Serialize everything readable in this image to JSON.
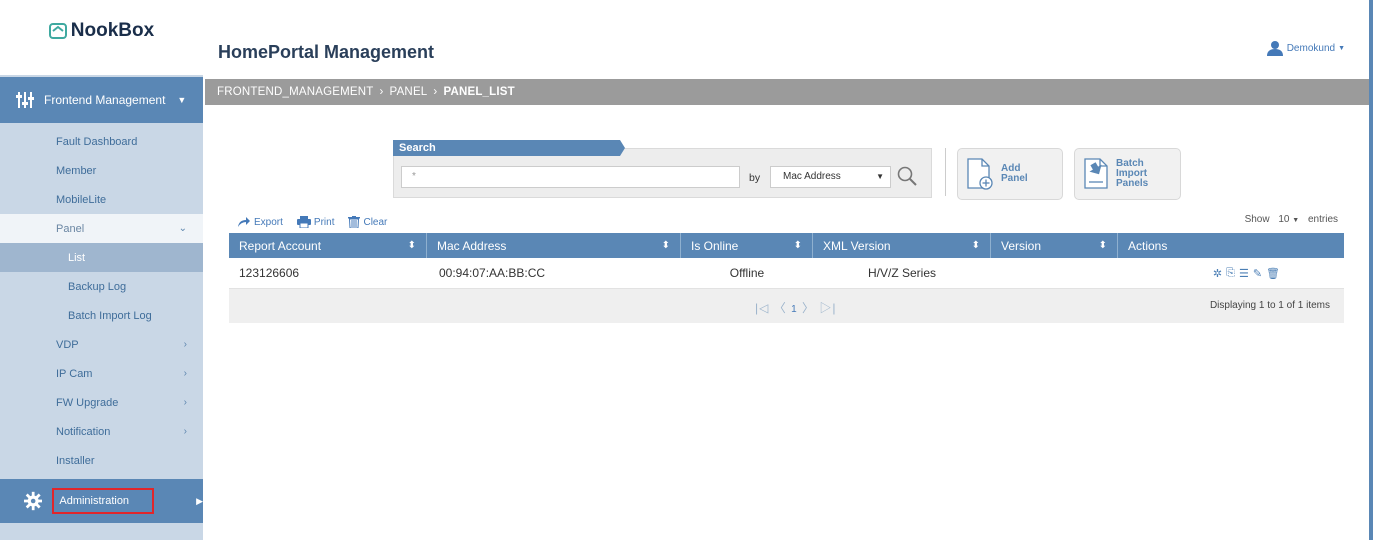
{
  "brand": {
    "logo_text": "NookBox"
  },
  "header": {
    "title": "HomePortal Management",
    "user_name": "Demokund"
  },
  "breadcrumb": {
    "part1": "FRONTEND_MANAGEMENT",
    "part2": "PANEL",
    "part3": "PANEL_LIST",
    "separator": "›"
  },
  "sidebar": {
    "section_label": "Frontend Management",
    "items": [
      {
        "label": "Fault Dashboard"
      },
      {
        "label": "Member"
      },
      {
        "label": "MobileLite"
      },
      {
        "label": "Panel"
      },
      {
        "label": "List"
      },
      {
        "label": "Backup Log"
      },
      {
        "label": "Batch Import Log"
      },
      {
        "label": "VDP"
      },
      {
        "label": "IP Cam"
      },
      {
        "label": "FW Upgrade"
      },
      {
        "label": "Notification"
      },
      {
        "label": "Installer"
      }
    ],
    "admin_label": "Administration"
  },
  "search": {
    "tab_label": "Search",
    "input_value": "",
    "input_placeholder": "*",
    "by_label": "by",
    "field_selected": "Mac Address"
  },
  "buttons": {
    "add_panel": [
      "Add",
      "Panel"
    ],
    "batch_import": [
      "Batch",
      "Import",
      "Panels"
    ]
  },
  "toolbar": {
    "export": "Export",
    "print": "Print",
    "clear": "Clear"
  },
  "entries": {
    "show": "Show",
    "count": "10",
    "suffix": "entries"
  },
  "table": {
    "columns": [
      "Report Account",
      "Mac Address",
      "Is Online",
      "XML Version",
      "Version",
      "Actions"
    ],
    "rows": [
      {
        "report_account": "123126606",
        "mac_address": "00:94:07:AA:BB:CC",
        "is_online": "Offline",
        "xml_version": "H/V/Z Series",
        "version": ""
      }
    ]
  },
  "pagination": {
    "current_page": "1",
    "display_text": "Displaying 1 to 1 of 1 items"
  },
  "colors": {
    "primary": "#5a87b5",
    "sidebar_bg": "#c9d7e6",
    "breadcrumb_bg": "#9b9b9b",
    "highlight_red": "#e0262b"
  }
}
